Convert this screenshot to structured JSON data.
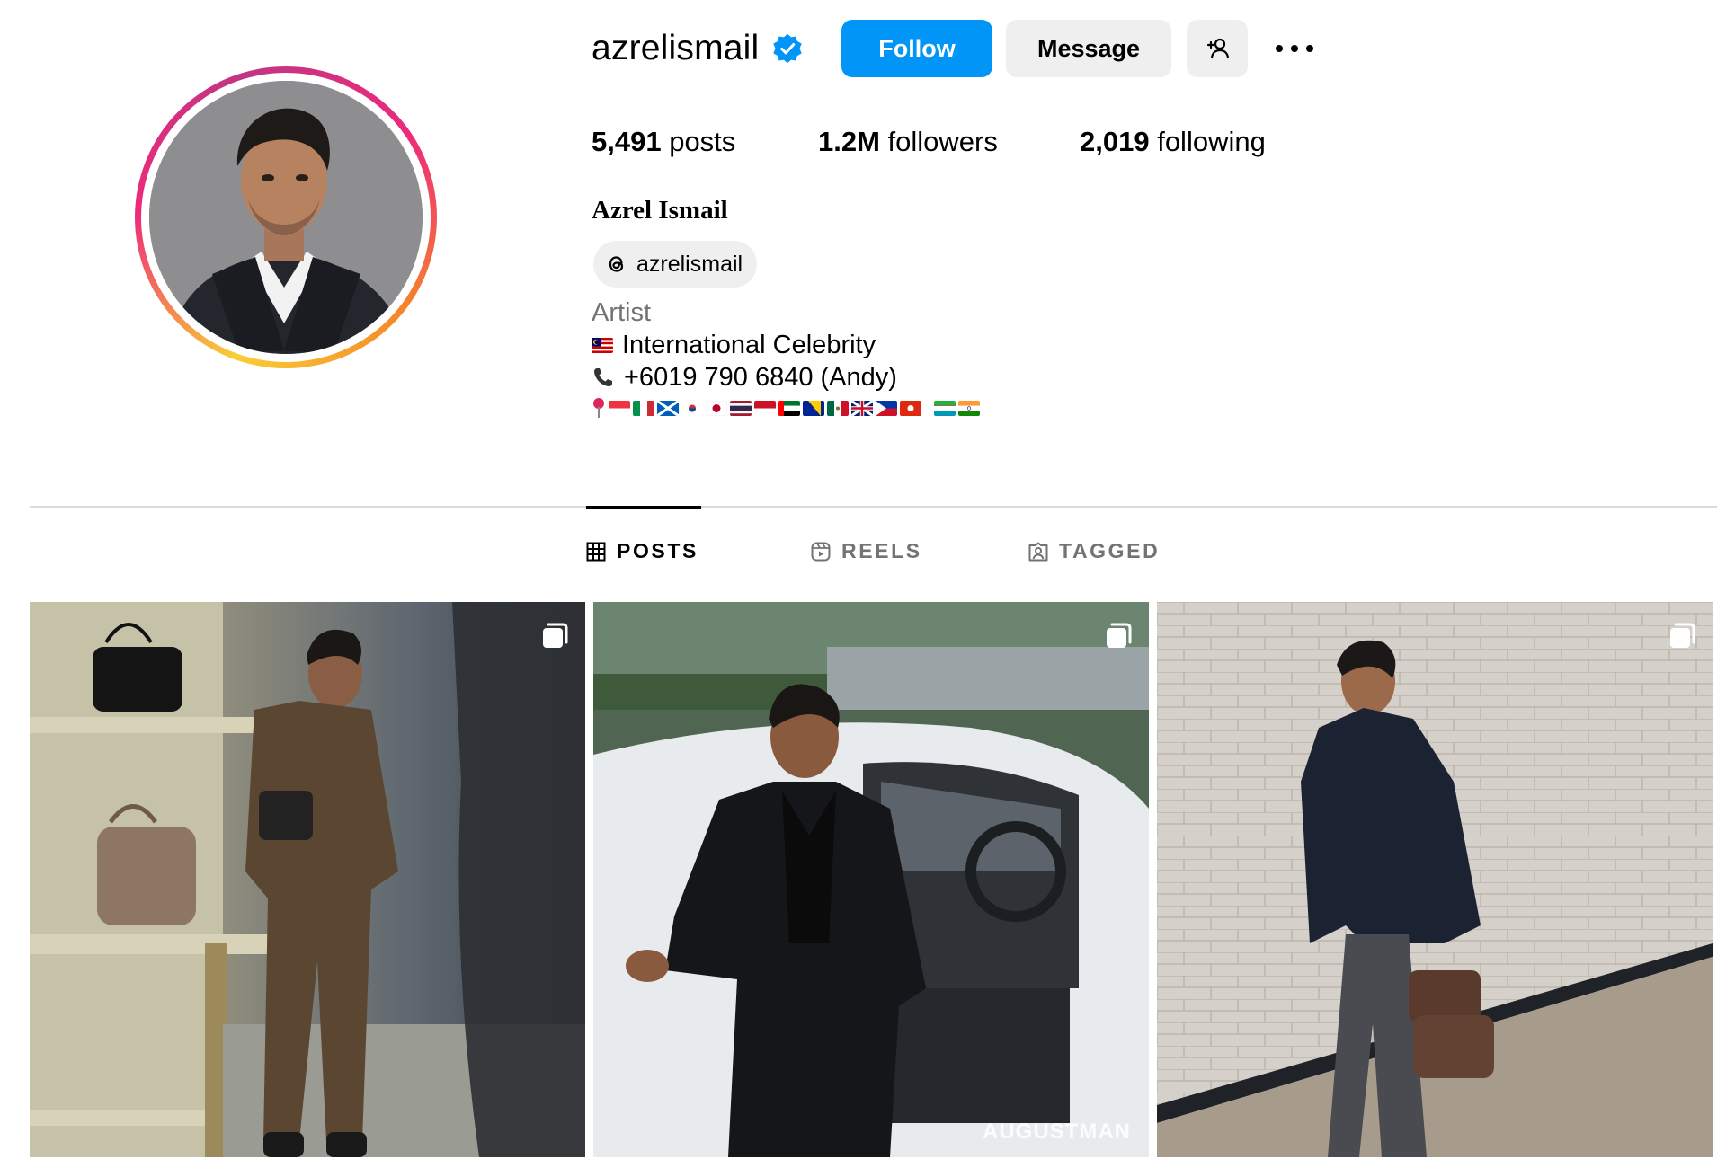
{
  "profile": {
    "username": "azrelismail",
    "verified": true,
    "accent_color": "#0095f6",
    "buttons": {
      "follow": "Follow",
      "message": "Message"
    },
    "stats": {
      "posts_count": "5,491",
      "posts_label": "posts",
      "followers_count": "1.2M",
      "followers_label": "followers",
      "following_count": "2,019",
      "following_label": "following"
    },
    "full_name": "Azrel Ismail",
    "threads_handle": "azrelismail",
    "category": "Artist",
    "bio_lines": [
      {
        "emoji": "malaysia-flag",
        "text": "International Celebrity"
      },
      {
        "emoji": "phone-icon",
        "text": "+6019 790 6840 (Andy)"
      }
    ],
    "location_flags": [
      "location-pin",
      "singapore",
      "italy",
      "scotland",
      "south-korea",
      "japan",
      "thailand",
      "indonesia",
      "uae",
      "bosnia",
      "mexico",
      "uk",
      "philippines",
      "hong-kong",
      "uzbekistan",
      "india"
    ]
  },
  "tabs": [
    {
      "label": "POSTS",
      "icon": "grid-icon",
      "active": true
    },
    {
      "label": "REELS",
      "icon": "reels-icon",
      "active": false
    },
    {
      "label": "TAGGED",
      "icon": "tagged-icon",
      "active": false
    }
  ],
  "posts": [
    {
      "scene": "brown-suit-handbags",
      "carousel": true
    },
    {
      "scene": "black-suit-car",
      "carousel": true,
      "watermark": "AUGUSTMAN"
    },
    {
      "scene": "navy-coat-brick-wall",
      "carousel": true
    }
  ]
}
